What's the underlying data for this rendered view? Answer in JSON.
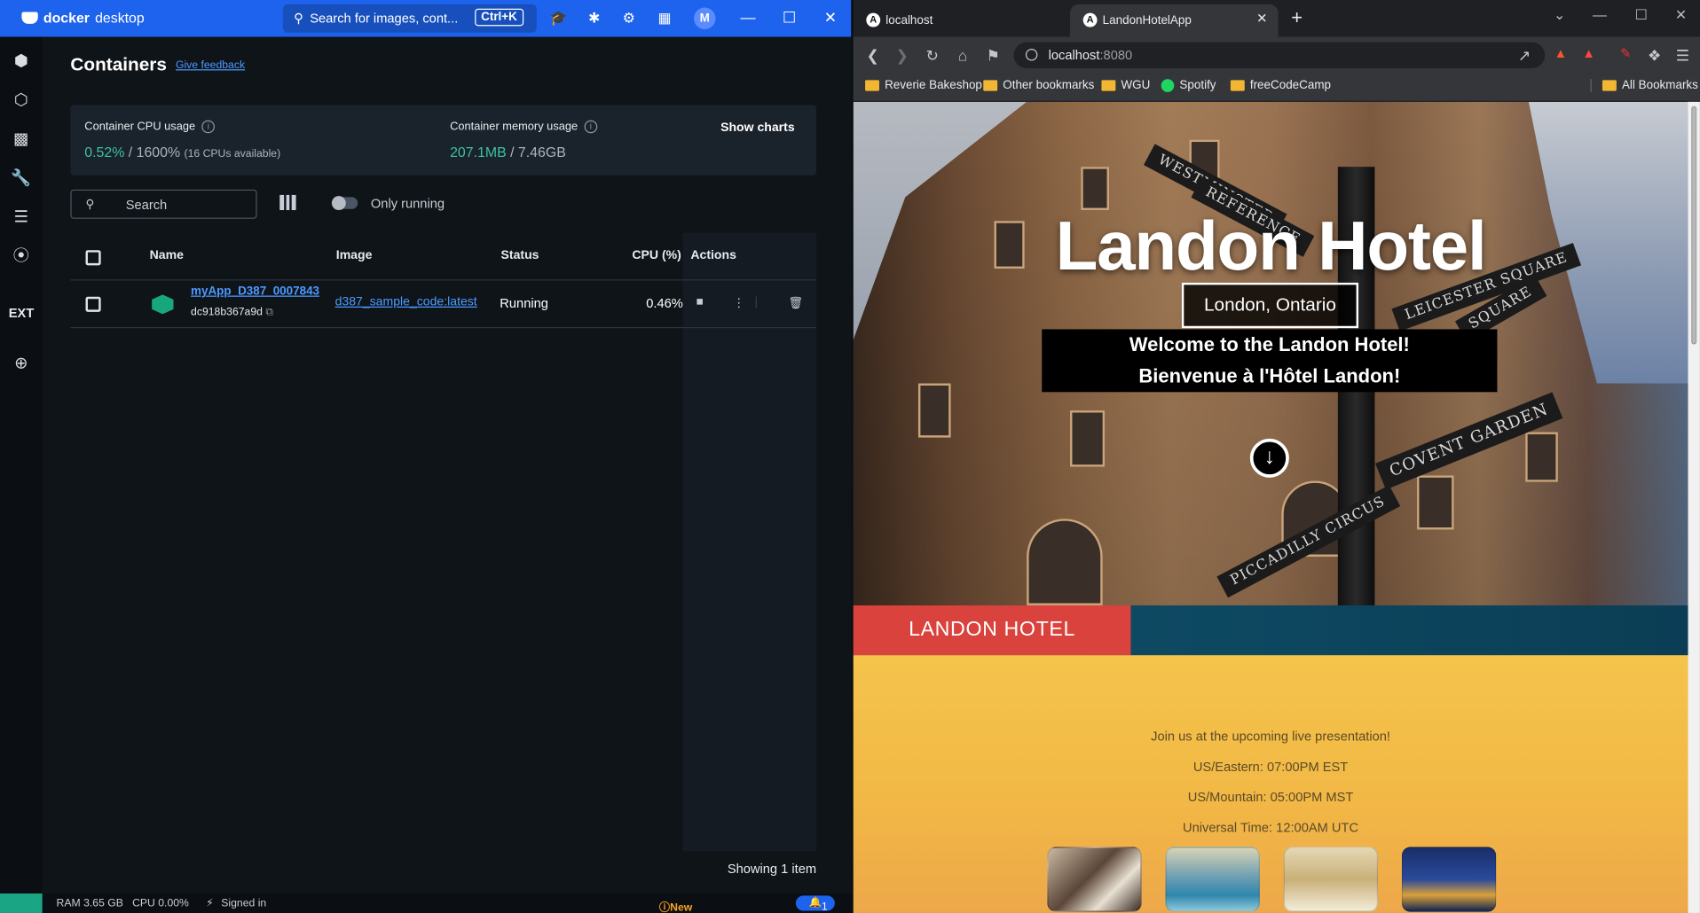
{
  "docker": {
    "brand_main": "docker",
    "brand_sub": "desktop",
    "search_placeholder": "Search for images, cont...",
    "search_shortcut": "Ctrl+K",
    "avatar_initial": "M",
    "title": "Containers",
    "feedback": "Give feedback",
    "stats": {
      "cpu_label": "Container CPU usage",
      "cpu_value": "0.52%",
      "cpu_total": "1600%",
      "cpu_note": "(16 CPUs available)",
      "mem_label": "Container memory usage",
      "mem_value": "207.1MB",
      "mem_total": "7.46GB",
      "show_charts": "Show charts"
    },
    "search_label": "Search",
    "only_running": "Only running",
    "columns": {
      "name": "Name",
      "image": "Image",
      "status": "Status",
      "cpu": "CPU (%)",
      "actions": "Actions"
    },
    "rows": [
      {
        "name": "myApp_D387_0007843",
        "id": "dc918b367a9d",
        "image": "d387_sample_code:latest",
        "status": "Running",
        "cpu": "0.46%"
      }
    ],
    "showing": "Showing 1 item",
    "sidebar_ext": "EXT",
    "statusbar": {
      "ram": "RAM 3.65 GB",
      "cpu": "CPU 0.00%",
      "signed": "Signed in",
      "new_version": "New version available",
      "notifications": "1"
    }
  },
  "browser": {
    "tabs": [
      {
        "label": "localhost",
        "favicon": "A"
      },
      {
        "label": "LandonHotelApp",
        "favicon": "A"
      }
    ],
    "url_host": "localhost",
    "url_port": ":8080",
    "bookmarks": [
      "Reverie Bakeshop",
      "Other bookmarks",
      "WGU",
      "Spotify",
      "freeCodeCamp"
    ],
    "all_bookmarks": "All Bookmarks"
  },
  "page": {
    "hero_title": "Landon Hotel",
    "hero_location": "London, Ontario",
    "welcome_en": "Welcome to the Landon Hotel!",
    "welcome_fr": "Bienvenue à l'Hôtel Landon!",
    "street_signs": [
      "WESTMINSTER",
      "REFERENCE",
      "LEICESTER SQUARE",
      "SQUARE",
      "COVENT GARDEN",
      "PICCADILLY CIRCUS"
    ],
    "band_title": "LANDON HOTEL",
    "presentation": [
      "Join us at the upcoming live presentation!",
      "US/Eastern: 07:00PM EST",
      "US/Mountain: 05:00PM MST",
      "Universal Time: 12:00AM UTC"
    ]
  },
  "colors": {
    "docker_blue": "#1d63ed",
    "docker_green": "#3ec1a0",
    "link_blue": "#4c9aff",
    "landon_red": "#d9423d",
    "landon_teal": "#0f4f6a",
    "landon_gold": "#f4c44b"
  }
}
